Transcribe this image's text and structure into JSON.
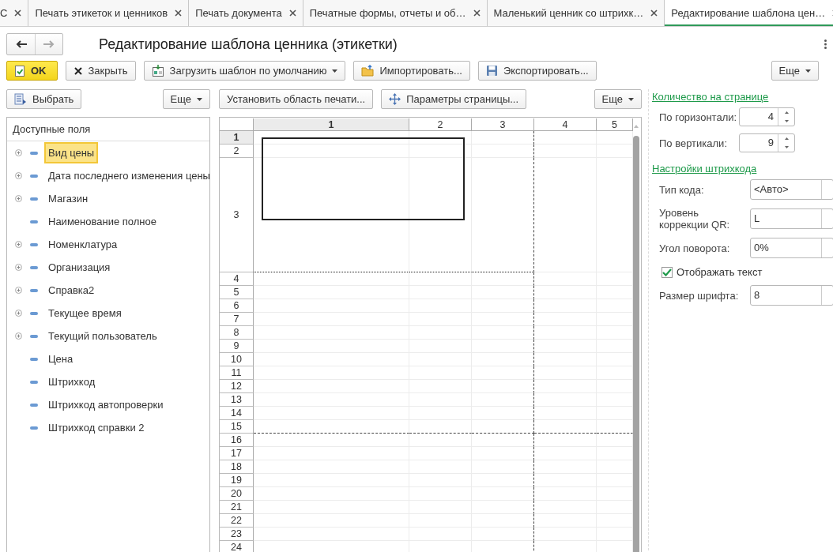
{
  "tabs": [
    {
      "label": "С",
      "selected": false
    },
    {
      "label": "Печать этикеток и ценников",
      "selected": false
    },
    {
      "label": "Печать документа",
      "selected": false
    },
    {
      "label": "Печатные формы, отчеты и об…",
      "selected": false
    },
    {
      "label": "Маленький ценник со штрихк…",
      "selected": false
    },
    {
      "label": "Редактирование шаблона цен…",
      "selected": true
    }
  ],
  "window": {
    "title": "Редактирование шаблона ценника (этикетки)"
  },
  "toolbar": {
    "buttons": [
      {
        "kind": "ok",
        "label": "OK",
        "dropdown": false
      },
      {
        "kind": "close",
        "label": "Закрыть",
        "dropdown": false
      },
      {
        "kind": "load",
        "label": "Загрузить шаблон по умолчанию",
        "dropdown": true
      },
      {
        "kind": "import",
        "label": "Импортировать...",
        "dropdown": false
      },
      {
        "kind": "export",
        "label": "Экспортировать...",
        "dropdown": false
      },
      {
        "kind": "more",
        "label": "Еще",
        "dropdown": true
      }
    ]
  },
  "fields_panel": {
    "buttons": [
      {
        "kind": "select",
        "label": "Выбрать",
        "dropdown": false
      },
      {
        "kind": "more",
        "label": "Еще",
        "dropdown": true
      }
    ],
    "header": "Доступные поля",
    "items": [
      {
        "label": "Вид цены",
        "expandable": true,
        "selected": true
      },
      {
        "label": "Дата последнего изменения цены",
        "expandable": true,
        "selected": false
      },
      {
        "label": "Магазин",
        "expandable": true,
        "selected": false
      },
      {
        "label": "Наименование полное",
        "expandable": false,
        "selected": false
      },
      {
        "label": "Номенклатура",
        "expandable": true,
        "selected": false
      },
      {
        "label": "Организация",
        "expandable": true,
        "selected": false
      },
      {
        "label": "Справка2",
        "expandable": true,
        "selected": false
      },
      {
        "label": "Текущее время",
        "expandable": true,
        "selected": false
      },
      {
        "label": "Текущий пользователь",
        "expandable": true,
        "selected": false
      },
      {
        "label": "Цена",
        "expandable": false,
        "selected": false
      },
      {
        "label": "Штрихкод",
        "expandable": false,
        "selected": false
      },
      {
        "label": "Штрихкод автопроверки",
        "expandable": false,
        "selected": false
      },
      {
        "label": "Штрихкод справки 2",
        "expandable": false,
        "selected": false
      }
    ]
  },
  "sheet": {
    "buttons": [
      {
        "kind": "print-area",
        "label": "Установить область печати...",
        "dropdown": false
      },
      {
        "kind": "page-setup",
        "label": "Параметры страницы...",
        "dropdown": false
      },
      {
        "kind": "more",
        "label": "Еще",
        "dropdown": true
      }
    ],
    "columns": [
      {
        "label": "1",
        "selected": true
      },
      {
        "label": "2",
        "selected": false
      },
      {
        "label": "3",
        "selected": false
      },
      {
        "label": "4",
        "selected": false
      },
      {
        "label": "5",
        "selected": false
      }
    ],
    "rows": [
      {
        "label": "1",
        "selected": true
      },
      {
        "label": "2",
        "selected": false
      },
      {
        "label": "3",
        "selected": false
      },
      {
        "label": "4",
        "selected": false
      },
      {
        "label": "5",
        "selected": false
      },
      {
        "label": "6",
        "selected": false
      },
      {
        "label": "7",
        "selected": false
      },
      {
        "label": "8",
        "selected": false
      },
      {
        "label": "9",
        "selected": false
      },
      {
        "label": "10",
        "selected": false
      },
      {
        "label": "11",
        "selected": false
      },
      {
        "label": "12",
        "selected": false
      },
      {
        "label": "13",
        "selected": false
      },
      {
        "label": "14",
        "selected": false
      },
      {
        "label": "15",
        "selected": false
      },
      {
        "label": "16",
        "selected": false
      },
      {
        "label": "17",
        "selected": false
      },
      {
        "label": "18",
        "selected": false
      },
      {
        "label": "19",
        "selected": false
      },
      {
        "label": "20",
        "selected": false
      },
      {
        "label": "21",
        "selected": false
      },
      {
        "label": "22",
        "selected": false
      },
      {
        "label": "23",
        "selected": false
      },
      {
        "label": "24",
        "selected": false
      }
    ]
  },
  "settings": [
    {
      "title": "Количество на странице",
      "fields": [
        {
          "kind": "spin",
          "label": "По горизонтали:",
          "value": "4"
        },
        {
          "kind": "spin",
          "label": "По вертикали:",
          "value": "9"
        }
      ]
    },
    {
      "title": "Настройки штрихкода",
      "fields": [
        {
          "kind": "select",
          "label": "Тип кода:",
          "value": "<Авто>"
        },
        {
          "kind": "select",
          "label": "Уровень коррекции QR:",
          "value": "L"
        },
        {
          "kind": "select",
          "label": "Угол поворота:",
          "value": "0%"
        },
        {
          "kind": "checkbox",
          "label": "Отображать текст",
          "checked": true
        },
        {
          "kind": "select",
          "label": "Размер шрифта:",
          "value": "8"
        }
      ]
    }
  ]
}
